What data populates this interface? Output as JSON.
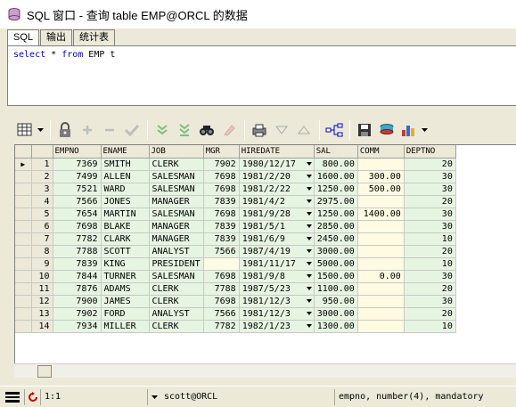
{
  "window": {
    "title": "SQL 窗口 - 查询 table EMP@ORCL 的数据"
  },
  "tabs": [
    {
      "label": "SQL",
      "active": true
    },
    {
      "label": "输出",
      "active": false
    },
    {
      "label": "统计表",
      "active": false
    }
  ],
  "editor": {
    "tokens": [
      {
        "text": "select",
        "kind": "keyword"
      },
      {
        "text": " * ",
        "kind": "plain"
      },
      {
        "text": "from",
        "kind": "keyword"
      },
      {
        "text": " EMP t",
        "kind": "plain"
      }
    ]
  },
  "toolbar": {
    "icons": [
      "grid-layout-icon",
      "dropdown-arrow-icon",
      "lock-icon",
      "add-record-icon",
      "delete-record-icon",
      "post-changes-icon",
      "fetch-next-icon",
      "fetch-last-icon",
      "find-icon",
      "clear-icon",
      "print-icon",
      "filter-down-icon",
      "filter-up-icon",
      "query-by-example-icon",
      "save-icon",
      "export-icon",
      "chart-icon"
    ]
  },
  "grid": {
    "columns": [
      "EMPNO",
      "ENAME",
      "JOB",
      "MGR",
      "HIREDATE",
      "SAL",
      "COMM",
      "DEPTNO"
    ],
    "rows": [
      {
        "n": "1",
        "empno": "7369",
        "ename": "SMITH",
        "job": "CLERK",
        "mgr": "7902",
        "hiredate": "1980/12/17",
        "sal": "800.00",
        "comm": "",
        "deptno": "20"
      },
      {
        "n": "2",
        "empno": "7499",
        "ename": "ALLEN",
        "job": "SALESMAN",
        "mgr": "7698",
        "hiredate": "1981/2/20",
        "sal": "1600.00",
        "comm": "300.00",
        "deptno": "30"
      },
      {
        "n": "3",
        "empno": "7521",
        "ename": "WARD",
        "job": "SALESMAN",
        "mgr": "7698",
        "hiredate": "1981/2/22",
        "sal": "1250.00",
        "comm": "500.00",
        "deptno": "30"
      },
      {
        "n": "4",
        "empno": "7566",
        "ename": "JONES",
        "job": "MANAGER",
        "mgr": "7839",
        "hiredate": "1981/4/2",
        "sal": "2975.00",
        "comm": "",
        "deptno": "20"
      },
      {
        "n": "5",
        "empno": "7654",
        "ename": "MARTIN",
        "job": "SALESMAN",
        "mgr": "7698",
        "hiredate": "1981/9/28",
        "sal": "1250.00",
        "comm": "1400.00",
        "deptno": "30"
      },
      {
        "n": "6",
        "empno": "7698",
        "ename": "BLAKE",
        "job": "MANAGER",
        "mgr": "7839",
        "hiredate": "1981/5/1",
        "sal": "2850.00",
        "comm": "",
        "deptno": "30"
      },
      {
        "n": "7",
        "empno": "7782",
        "ename": "CLARK",
        "job": "MANAGER",
        "mgr": "7839",
        "hiredate": "1981/6/9",
        "sal": "2450.00",
        "comm": "",
        "deptno": "10"
      },
      {
        "n": "8",
        "empno": "7788",
        "ename": "SCOTT",
        "job": "ANALYST",
        "mgr": "7566",
        "hiredate": "1987/4/19",
        "sal": "3000.00",
        "comm": "",
        "deptno": "20"
      },
      {
        "n": "9",
        "empno": "7839",
        "ename": "KING",
        "job": "PRESIDENT",
        "mgr": "",
        "hiredate": "1981/11/17",
        "sal": "5000.00",
        "comm": "",
        "deptno": "10"
      },
      {
        "n": "10",
        "empno": "7844",
        "ename": "TURNER",
        "job": "SALESMAN",
        "mgr": "7698",
        "hiredate": "1981/9/8",
        "sal": "1500.00",
        "comm": "0.00",
        "deptno": "30"
      },
      {
        "n": "11",
        "empno": "7876",
        "ename": "ADAMS",
        "job": "CLERK",
        "mgr": "7788",
        "hiredate": "1987/5/23",
        "sal": "1100.00",
        "comm": "",
        "deptno": "20"
      },
      {
        "n": "12",
        "empno": "7900",
        "ename": "JAMES",
        "job": "CLERK",
        "mgr": "7698",
        "hiredate": "1981/12/3",
        "sal": "950.00",
        "comm": "",
        "deptno": "30"
      },
      {
        "n": "13",
        "empno": "7902",
        "ename": "FORD",
        "job": "ANALYST",
        "mgr": "7566",
        "hiredate": "1981/12/3",
        "sal": "3000.00",
        "comm": "",
        "deptno": "20"
      },
      {
        "n": "14",
        "empno": "7934",
        "ename": "MILLER",
        "job": "CLERK",
        "mgr": "7782",
        "hiredate": "1982/1/23",
        "sal": "1300.00",
        "comm": "",
        "deptno": "10"
      }
    ]
  },
  "statusbar": {
    "position": "1:1",
    "connection": "scott@ORCL",
    "field_info": "empno, number(4), mandatory"
  },
  "colors": {
    "keyword": "#0000c8",
    "cell_highlight": "#e6f5e1",
    "null_cell": "#fffbe2"
  }
}
